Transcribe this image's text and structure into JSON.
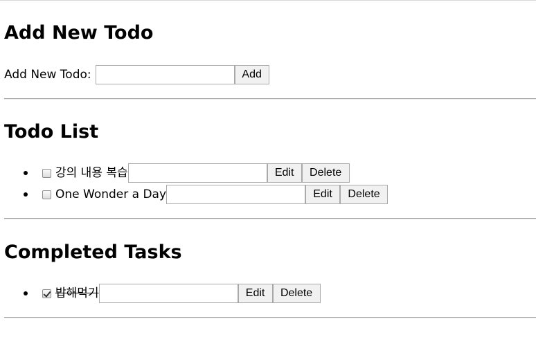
{
  "add_section": {
    "heading": "Add New Todo",
    "label": "Add New Todo:",
    "input_value": "",
    "add_button": "Add"
  },
  "todo_section": {
    "heading": "Todo List",
    "items": [
      {
        "text": "강의 내용 복습",
        "checked": false,
        "edit_value": "",
        "edit_label": "Edit",
        "delete_label": "Delete"
      },
      {
        "text": "One Wonder a Day",
        "checked": false,
        "edit_value": "",
        "edit_label": "Edit",
        "delete_label": "Delete"
      }
    ]
  },
  "completed_section": {
    "heading": "Completed Tasks",
    "items": [
      {
        "text": "밥해먹기",
        "checked": true,
        "edit_value": "",
        "edit_label": "Edit",
        "delete_label": "Delete"
      }
    ]
  }
}
